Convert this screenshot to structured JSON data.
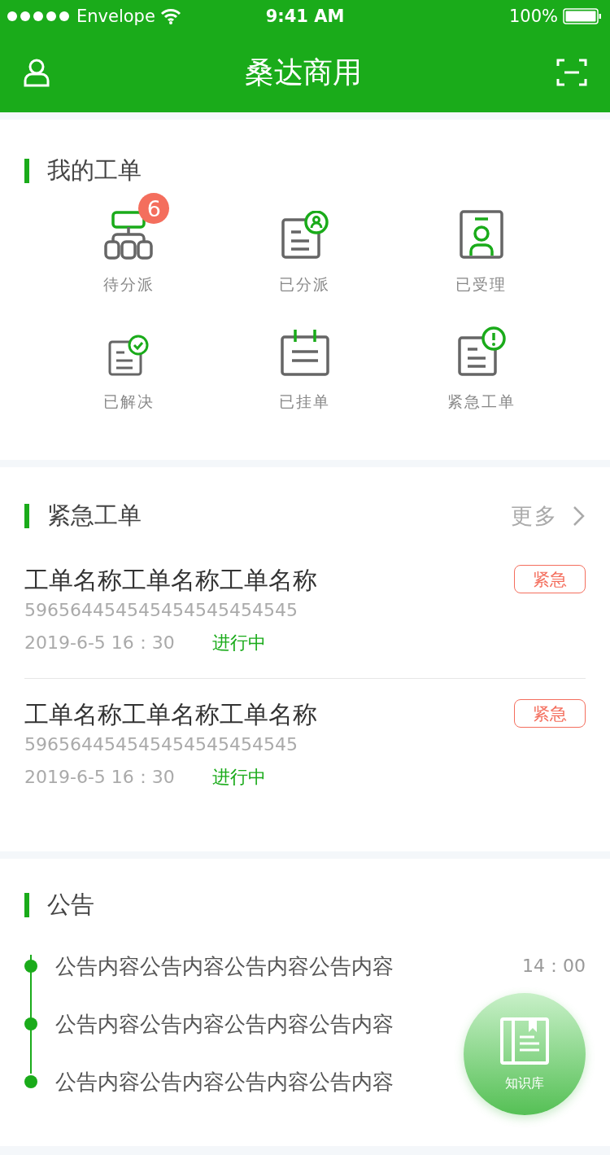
{
  "status_bar": {
    "carrier": "Envelope",
    "time": "9:41 AM",
    "battery": "100%"
  },
  "nav": {
    "title": "桑达商用"
  },
  "my_orders": {
    "title": "我的工单",
    "items": [
      {
        "kind": "hierarchy",
        "label": "待分派",
        "badge": "6"
      },
      {
        "kind": "doc-user",
        "label": "已分派"
      },
      {
        "kind": "id-card",
        "label": "已受理"
      },
      {
        "kind": "doc-check",
        "label": "已解决"
      },
      {
        "kind": "calendar",
        "label": "已挂单"
      },
      {
        "kind": "doc-alert",
        "label": "紧急工单"
      }
    ]
  },
  "urgent": {
    "title": "紧急工单",
    "more": "更多",
    "orders": [
      {
        "name": "工单名称工单名称工单名称",
        "number": "596564454545454545454545",
        "datetime": "2019-6-5 16：30",
        "status": "进行中",
        "tag": "紧急"
      },
      {
        "name": "工单名称工单名称工单名称",
        "number": "596564454545454545454545",
        "datetime": "2019-6-5 16：30",
        "status": "进行中",
        "tag": "紧急"
      }
    ]
  },
  "notices": {
    "title": "公告",
    "items": [
      {
        "text": "公告内容公告内容公告内容公告内容",
        "time": "14：00"
      },
      {
        "text": "公告内容公告内容公告内容公告内容"
      },
      {
        "text": "公告内容公告内容公告内容公告内容"
      }
    ]
  },
  "fab": {
    "label": "知识库"
  }
}
